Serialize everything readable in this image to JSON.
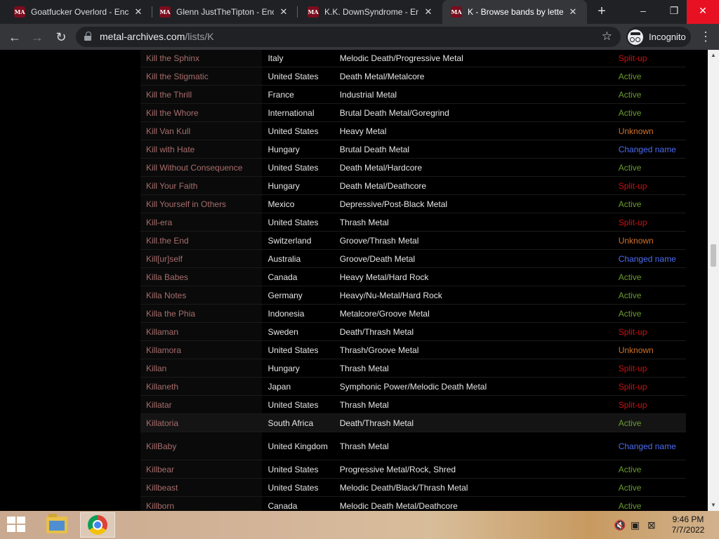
{
  "browser": {
    "tabs": [
      {
        "title": "Goatfucker Overlord - Ency",
        "active": false
      },
      {
        "title": "Glenn JustTheTipton - Ency",
        "active": false
      },
      {
        "title": "K.K. DownSyndrome - Ency",
        "active": false
      },
      {
        "title": "K - Browse bands by letter",
        "active": true
      }
    ],
    "tab_favicon_text": "MA",
    "url_host": "metal-archives.com",
    "url_path": "/lists/K",
    "incognito_label": "Incognito"
  },
  "bands": [
    {
      "name": "Kill the Sphinx",
      "country": "Italy",
      "genre": "Melodic Death/Progressive Metal",
      "status": "Split-up"
    },
    {
      "name": "Kill the Stigmatic",
      "country": "United States",
      "genre": "Death Metal/Metalcore",
      "status": "Active"
    },
    {
      "name": "Kill the Thrill",
      "country": "France",
      "genre": "Industrial Metal",
      "status": "Active"
    },
    {
      "name": "Kill the Whore",
      "country": "International",
      "genre": "Brutal Death Metal/Goregrind",
      "status": "Active"
    },
    {
      "name": "Kill Van Kull",
      "country": "United States",
      "genre": "Heavy Metal",
      "status": "Unknown"
    },
    {
      "name": "Kill with Hate",
      "country": "Hungary",
      "genre": "Brutal Death Metal",
      "status": "Changed name"
    },
    {
      "name": "Kill Without Consequence",
      "country": "United States",
      "genre": "Death Metal/Hardcore",
      "status": "Active"
    },
    {
      "name": "Kill Your Faith",
      "country": "Hungary",
      "genre": "Death Metal/Deathcore",
      "status": "Split-up"
    },
    {
      "name": "Kill Yourself in Others",
      "country": "Mexico",
      "genre": "Depressive/Post-Black Metal",
      "status": "Active"
    },
    {
      "name": "Kill-era",
      "country": "United States",
      "genre": "Thrash Metal",
      "status": "Split-up"
    },
    {
      "name": "Kill.the End",
      "country": "Switzerland",
      "genre": "Groove/Thrash Metal",
      "status": "Unknown"
    },
    {
      "name": "Kill[ur]self",
      "country": "Australia",
      "genre": "Groove/Death Metal",
      "status": "Changed name"
    },
    {
      "name": "Killa Babes",
      "country": "Canada",
      "genre": "Heavy Metal/Hard Rock",
      "status": "Active"
    },
    {
      "name": "Killa Notes",
      "country": "Germany",
      "genre": "Heavy/Nu-Metal/Hard Rock",
      "status": "Active"
    },
    {
      "name": "Killa the Phia",
      "country": "Indonesia",
      "genre": "Metalcore/Groove Metal",
      "status": "Active"
    },
    {
      "name": "Killaman",
      "country": "Sweden",
      "genre": "Death/Thrash Metal",
      "status": "Split-up"
    },
    {
      "name": "Killamora",
      "country": "United States",
      "genre": "Thrash/Groove Metal",
      "status": "Unknown"
    },
    {
      "name": "Killan",
      "country": "Hungary",
      "genre": "Thrash Metal",
      "status": "Split-up"
    },
    {
      "name": "Killaneth",
      "country": "Japan",
      "genre": "Symphonic Power/Melodic Death Metal",
      "status": "Split-up"
    },
    {
      "name": "Killatar",
      "country": "United States",
      "genre": "Thrash Metal",
      "status": "Split-up"
    },
    {
      "name": "Killatoria",
      "country": "South Africa",
      "genre": "Death/Thrash Metal",
      "status": "Active"
    },
    {
      "name": "KillBaby",
      "country": "United Kingdom",
      "genre": "Thrash Metal",
      "status": "Changed name"
    },
    {
      "name": "Killbear",
      "country": "United States",
      "genre": "Progressive Metal/Rock, Shred",
      "status": "Active"
    },
    {
      "name": "Killbeast",
      "country": "United States",
      "genre": "Melodic Death/Black/Thrash Metal",
      "status": "Active"
    },
    {
      "name": "Killborn",
      "country": "Canada",
      "genre": "Melodic Death Metal/Deathcore",
      "status": "Active"
    }
  ],
  "status_colors": {
    "Active": "#6a9b2e",
    "Split-up": "#cc1010",
    "Unknown": "#d0722a",
    "Changed name": "#4e6cf2"
  },
  "taskbar": {
    "time": "9:46 PM",
    "date": "7/7/2022"
  }
}
